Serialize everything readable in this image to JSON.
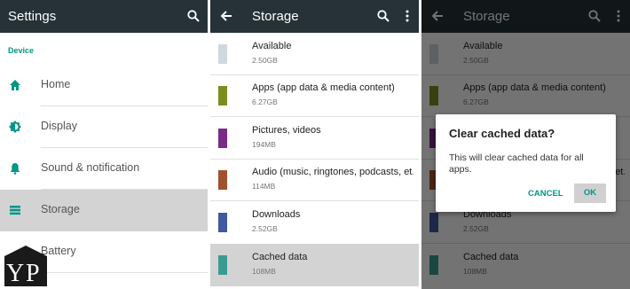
{
  "settings": {
    "title": "Settings",
    "section": "Device",
    "items": [
      {
        "label": "Home",
        "icon": "home-icon"
      },
      {
        "label": "Display",
        "icon": "brightness-icon"
      },
      {
        "label": "Sound & notification",
        "icon": "bell-icon"
      },
      {
        "label": "Storage",
        "icon": "storage-icon",
        "selected": true
      },
      {
        "label": "Battery",
        "icon": "battery-icon"
      }
    ]
  },
  "storage": {
    "title": "Storage",
    "items": [
      {
        "name": "Available",
        "size": "2.50GB",
        "color": "#cfd8dc"
      },
      {
        "name": "Apps (app data & media content)",
        "size": "6.27GB",
        "color": "#7e8c1e"
      },
      {
        "name": "Pictures, videos",
        "size": "194MB",
        "color": "#7b2a88"
      },
      {
        "name": "Audio (music, ringtones, podcasts, et...",
        "size": "114MB",
        "color": "#a0522d"
      },
      {
        "name": "Downloads",
        "size": "2.52GB",
        "color": "#3f5a9e"
      },
      {
        "name": "Cached data",
        "size": "108MB",
        "color": "#3c9b91",
        "selected": true
      }
    ]
  },
  "dialog": {
    "title": "Clear cached data?",
    "message": "This will clear cached data for all apps.",
    "cancel_label": "CANCEL",
    "ok_label": "OK"
  },
  "watermark": {
    "text": "YP"
  },
  "colors": {
    "appbar": "#263238",
    "accent": "#009688"
  }
}
